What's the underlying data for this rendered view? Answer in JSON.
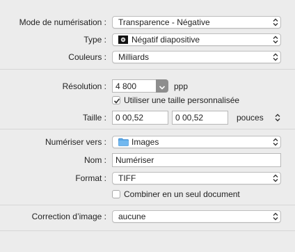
{
  "scan_mode": {
    "label": "Mode de numérisation :",
    "value": "Transparence - Négative"
  },
  "type": {
    "label": "Type :",
    "value": "Négatif diapositive",
    "icon": "film-negative-icon"
  },
  "colors": {
    "label": "Couleurs :",
    "value": "Milliards"
  },
  "resolution": {
    "label": "Résolution :",
    "value": "4 800",
    "unit": "ppp"
  },
  "custom_size": {
    "label": "Utiliser une taille personnalisée",
    "checked": true
  },
  "size": {
    "label": "Taille :",
    "width": "0 00,52",
    "height": "0 00,52",
    "unit": "pouces"
  },
  "destination": {
    "label": "Numériser vers :",
    "value": "Images",
    "icon": "folder-icon"
  },
  "name": {
    "label": "Nom :",
    "value": "Numériser"
  },
  "format": {
    "label": "Format :",
    "value": "TIFF"
  },
  "combine": {
    "label": "Combiner en un seul document",
    "checked": false
  },
  "correction": {
    "label": "Correction d’image :",
    "value": "aucune"
  },
  "colors_accent": {
    "folder": "#5aa8e6",
    "combo_button": "#8e8e8e",
    "check": "#333333"
  }
}
